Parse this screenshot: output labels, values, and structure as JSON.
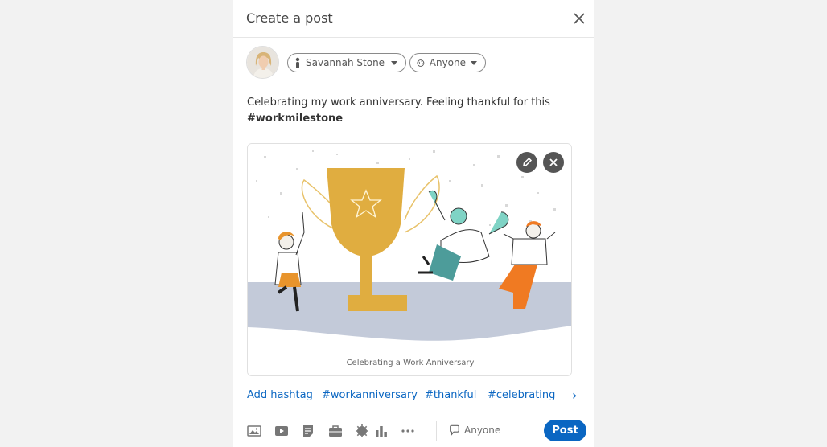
{
  "dialog": {
    "title": "Create a post"
  },
  "author": {
    "name": "Savannah Stone",
    "visibility": "Anyone"
  },
  "post": {
    "text": "Celebrating my work anniversary. Feeling thankful for this",
    "hashtag": "#workmilestone"
  },
  "media": {
    "caption": "Celebrating a Work Anniversary"
  },
  "hashtags": {
    "add_label": "Add hashtag",
    "items": [
      "#workanniversary",
      "#thankful",
      "#celebrating"
    ]
  },
  "toolbar": {
    "comment_visibility": "Anyone",
    "post_label": "Post"
  },
  "icons": [
    "close-icon",
    "person-icon",
    "globe-icon",
    "edit-icon",
    "remove-icon",
    "chevron-right-icon",
    "photo-icon",
    "video-icon",
    "document-icon",
    "briefcase-icon",
    "celebrate-icon",
    "chart-icon",
    "more-icon",
    "comment-icon"
  ],
  "colors": {
    "accent": "#0a66c2",
    "background": "#f2f2f2"
  }
}
